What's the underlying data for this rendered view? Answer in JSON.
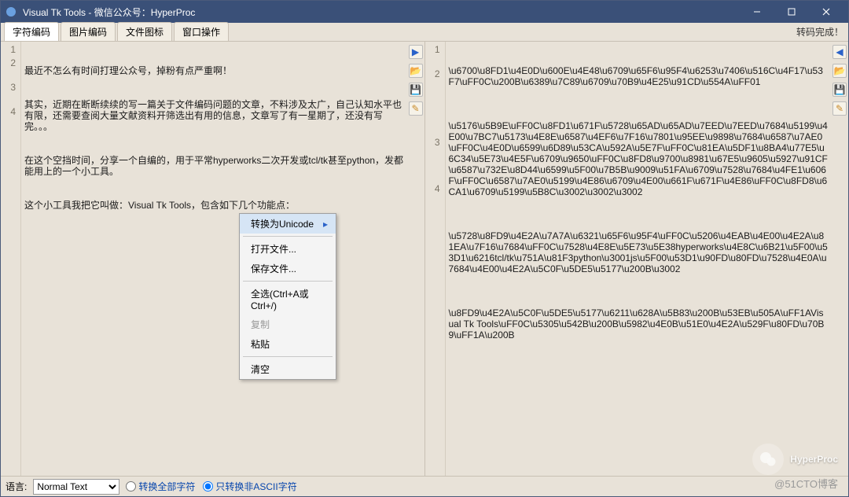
{
  "titlebar": {
    "title": "Visual Tk Tools - 微信公众号：HyperProc"
  },
  "tabs": {
    "items": [
      {
        "label": "字符编码",
        "active": true
      },
      {
        "label": "图片编码",
        "active": false
      },
      {
        "label": "文件图标",
        "active": false
      },
      {
        "label": "窗口操作",
        "active": false
      }
    ],
    "status": "转码完成！"
  },
  "left_pane": {
    "lines": [
      "最近不怎么有时间打理公众号，掉粉有点严重啊！",
      "其实，近期在断断续续的写一篇关于文件编码问题的文章，不料涉及太广，自己认知水平也有限，还需要查阅大量文献资料开筛选出有用的信息，文章写了有一星期了，还没有写完。。。",
      "在这个空挡时间，分享一个自编的，用于平常hyperworks二次开发或tcl/tk甚至python，发都能用上的一个小工具。",
      "这个小工具我把它叫做：Visual Tk Tools，包含如下几个功能点："
    ]
  },
  "right_pane": {
    "lines": [
      "\\u6700\\u8FD1\\u4E0D\\u600E\\u4E48\\u6709\\u65F6\\u95F4\\u6253\\u7406\\u516C\\u4F17\\u53F7\\uFF0C\\u200B\\u6389\\u7C89\\u6709\\u70B9\\u4E25\\u91CD\\u554A\\uFF01",
      "\\u5176\\u5B9E\\uFF0C\\u8FD1\\u671F\\u5728\\u65AD\\u65AD\\u7EED\\u7EED\\u7684\\u5199\\u4E00\\u7BC7\\u5173\\u4E8E\\u6587\\u4EF6\\u7F16\\u7801\\u95EE\\u9898\\u7684\\u6587\\u7AE0\\uFF0C\\u4E0D\\u6599\\u6D89\\u53CA\\u592A\\u5E7F\\uFF0C\\u81EA\\u5DF1\\u8BA4\\u77E5\\u6C34\\u5E73\\u4E5F\\u6709\\u9650\\uFF0C\\u8FD8\\u9700\\u8981\\u67E5\\u9605\\u5927\\u91CF\\u6587\\u732E\\u8D44\\u6599\\u5F00\\u7B5B\\u9009\\u51FA\\u6709\\u7528\\u7684\\u4FE1\\u606F\\uFF0C\\u6587\\u7AE0\\u5199\\u4E86\\u6709\\u4E00\\u661F\\u671F\\u4E86\\uFF0C\\u8FD8\\u6CA1\\u6709\\u5199\\u5B8C\\u3002\\u3002\\u3002",
      "\\u5728\\u8FD9\\u4E2A\\u7A7A\\u6321\\u65F6\\u95F4\\uFF0C\\u5206\\u4EAB\\u4E00\\u4E2A\\u81EA\\u7F16\\u7684\\uFF0C\\u7528\\u4E8E\\u5E73\\u5E38hyperworks\\u4E8C\\u6B21\\u5F00\\u53D1\\u6216tcl/tk\\u751A\\u81F3python\\u3001js\\u5F00\\u53D1\\u90FD\\u80FD\\u7528\\u4E0A\\u7684\\u4E00\\u4E2A\\u5C0F\\u5DE5\\u5177\\u200B\\u3002",
      "\\u8FD9\\u4E2A\\u5C0F\\u5DE5\\u5177\\u6211\\u628A\\u5B83\\u200B\\u53EB\\u505A\\uFF1AVisual Tk Tools\\uFF0C\\u5305\\u542B\\u200B\\u5982\\u4E0B\\u51E0\\u4E2A\\u529F\\u80FD\\u70B9\\uFF1A\\u200B"
    ]
  },
  "context_menu": {
    "convert_unicode": "转换为Unicode",
    "open_file": "打开文件...",
    "save_file": "保存文件...",
    "select_all": "全选(Ctrl+A或Ctrl+/)",
    "copy": "复制",
    "paste": "粘贴",
    "clear": "清空"
  },
  "bottom": {
    "lang_label": "语言:",
    "lang_value": "Normal Text",
    "radio_all": "转换全部字符",
    "radio_nonascii": "只转换非ASCII字符"
  },
  "side_icons": [
    "arrow-right",
    "folder-open",
    "save",
    "edit"
  ],
  "watermark": {
    "brand": "HyperProc",
    "blog": "@51CTO博客"
  }
}
